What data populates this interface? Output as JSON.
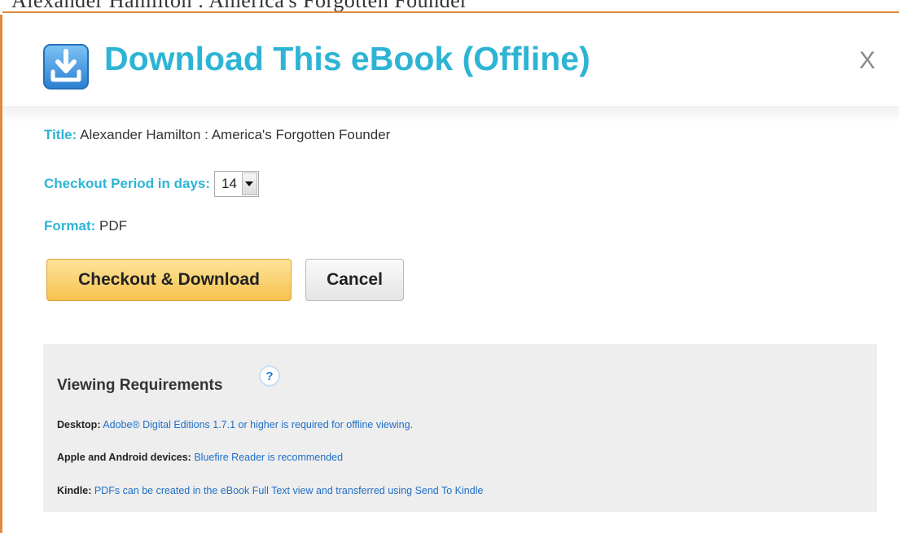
{
  "dialog": {
    "title": "Download This eBook (Offline)",
    "close_label": "X"
  },
  "fields": {
    "title_label": "Title:",
    "title_value": "Alexander Hamilton : America's Forgotten Founder",
    "period_label": "Checkout Period in days:",
    "period_value": "14",
    "format_label": "Format:",
    "format_value": "PDF"
  },
  "buttons": {
    "checkout_label": "Checkout & Download",
    "cancel_label": "Cancel"
  },
  "requirements": {
    "title": "Viewing Requirements",
    "help_glyph": "?",
    "items": [
      {
        "key": "Desktop:",
        "value": "Adobe® Digital Editions 1.7.1 or higher is required for offline viewing."
      },
      {
        "key": "Apple and Android devices:",
        "value": "Bluefire Reader is recommended"
      },
      {
        "key": "Kindle:",
        "value": "PDFs can be created in the eBook Full Text view and transferred using Send To Kindle"
      }
    ]
  },
  "icons": {
    "download": "download-icon",
    "help": "help-icon",
    "dropdown": "chevron-down-icon"
  },
  "colors": {
    "accent": "#2db4d5",
    "link": "#1f6fc6",
    "primary_button": "#f6c24f",
    "frame": "#e08a3c"
  }
}
